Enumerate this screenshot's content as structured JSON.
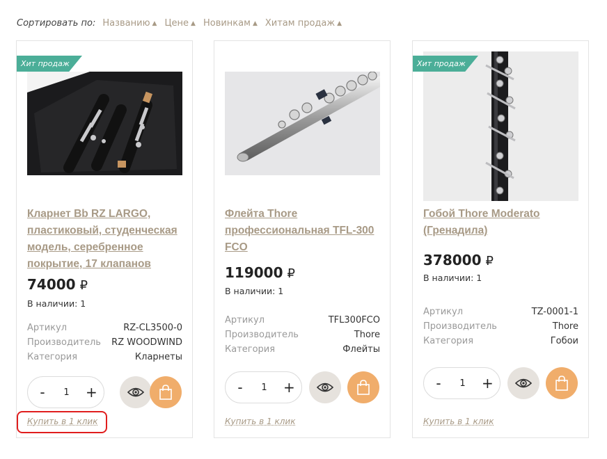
{
  "sort": {
    "label": "Сортировать по:",
    "options": [
      "Названию",
      "Цене",
      "Новинкам",
      "Хитам продаж"
    ],
    "arrow": "▲"
  },
  "products": [
    {
      "badge": "Хит продаж",
      "title": "Кларнет Bb RZ LARGO, пластиковый, студенческая модель, серебренное покрытие, 17 клапанов",
      "price": "74000",
      "currency": "₽",
      "stock": "В наличии: 1",
      "props": [
        {
          "k": "Артикул",
          "v": "RZ-CL3500-0"
        },
        {
          "k": "Производитель",
          "v": "RZ WOODWIND"
        },
        {
          "k": "Категория",
          "v": "Кларнеты"
        }
      ],
      "qty": "1",
      "oneclick": "Купить в 1 клик"
    },
    {
      "badge": "",
      "title": "Флейта Thore профессиональная TFL-300 FCO",
      "price": "119000",
      "currency": "₽",
      "stock": "В наличии: 1",
      "props": [
        {
          "k": "Артикул",
          "v": "TFL300FCO"
        },
        {
          "k": "Производитель",
          "v": "Thore"
        },
        {
          "k": "Категория",
          "v": "Флейты"
        }
      ],
      "qty": "1",
      "oneclick": "Купить в 1 клик"
    },
    {
      "badge": "Хит продаж",
      "title": "Гобой Thore Moderato (Гренадила)",
      "price": "378000",
      "currency": "₽",
      "stock": "В наличии: 1",
      "props": [
        {
          "k": "Артикул",
          "v": "TZ-0001-1"
        },
        {
          "k": "Производитель",
          "v": "Thore"
        },
        {
          "k": "Категория",
          "v": "Гобои"
        }
      ],
      "qty": "1",
      "oneclick": "Купить в 1 клик"
    }
  ],
  "buttons": {
    "minus": "-",
    "plus": "+"
  },
  "colors": {
    "accent": "#a89a86",
    "badge": "#4bae98",
    "cart": "#f0ad6b",
    "highlight": "#e01d1d"
  }
}
